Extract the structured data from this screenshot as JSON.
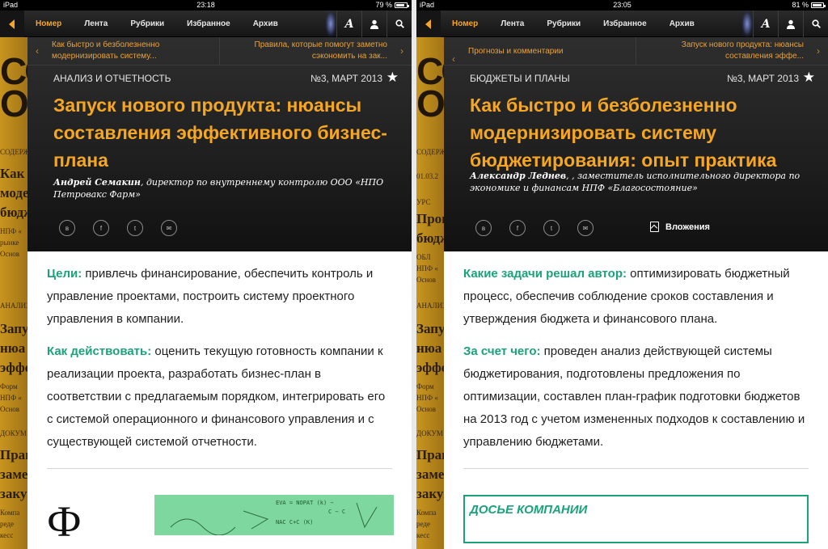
{
  "left": {
    "status": {
      "device": "iPad",
      "time": "23:18",
      "battery": "79 %",
      "battery_level": 0.79
    },
    "background_strip": [
      "СОДЕРЖ",
      "Как б",
      "моде",
      "бюдж",
      "НПФ «",
      "рынке",
      "Основ",
      "АНАЛИЗ",
      "Запу",
      "нюа",
      "эффе",
      "Форм",
      "НПФ «",
      "Основ",
      "ДОКУМ",
      "Прав",
      "заме",
      "закуп",
      "Компа",
      "реде",
      "кесс"
    ],
    "nav": {
      "tabs": [
        "Номер",
        "Лента",
        "Рубрики",
        "Избранное",
        "Архив"
      ],
      "active": "Номер",
      "font_button": "A"
    },
    "prev_link": "Как быстро и безболезненно модернизировать систему...",
    "next_link": "Правила, которые помогут заметно сэкономить на зак...",
    "rubric": "АНАЛИЗ И ОТЧЕТНОСТЬ",
    "issue": "№3, МАРТ 2013",
    "title": "Запуск нового продукта: нюансы составления эффективного бизнес-плана",
    "author_name": "Андрей Семакин",
    "author_role": ", директор по внутреннему контролю ООО «НПО Петровакс Фарм»",
    "share": [
      "в",
      "f",
      "t",
      "✉"
    ],
    "para1_label": "Цели:",
    "para1_text": " привлечь финансирование, обеспечить контроль и управление проектами, построить систему проектного управления в компании.",
    "para2_label": "Как действовать:",
    "para2_text": " оценить текущую готовность компании к реализации проекта, разработать бизнес-план в соответствии с предлагаемым порядком, интегрировать его с системой операционного и финансового управления и с существующей системой отчетности.",
    "big_letter": "Ф",
    "illus_text": [
      "EVA = NOPAT (k) −",
      "C − C",
      "NAC C+C (K)"
    ]
  },
  "right": {
    "status": {
      "device": "iPad",
      "time": "23:05",
      "battery": "81 %",
      "battery_level": 0.81
    },
    "background_strip": [
      "СОДЕРЖ",
      "01.03.2",
      "УРС",
      "Прог",
      "бюдж",
      "ОБЛ",
      "НПФ «",
      "Основ",
      "АНАЛИЗ",
      "Запу",
      "нюа",
      "эффе",
      "Форм",
      "НПФ «",
      "Основ",
      "ДОКУМ",
      "Прав",
      "заме",
      "закуп",
      "Компа",
      "реде",
      "кесс"
    ],
    "nav": {
      "tabs": [
        "Номер",
        "Лента",
        "Рубрики",
        "Избранное",
        "Архив"
      ],
      "active": "Номер",
      "font_button": "A"
    },
    "prev_link": "Прогнозы и комментарии",
    "next_link": "Запуск нового продукта: нюансы составления эффе...",
    "rubric": "БЮДЖЕТЫ И ПЛАНЫ",
    "issue": "№3, МАРТ 2013",
    "title": "Как быстро и безболезненно модернизировать систему бюджетирования: опыт практика",
    "author_name": "Александр Леднев",
    "author_role": ", , заместитель исполнительного директора по экономике и финансам НПФ «Благосостояние»",
    "share": [
      "в",
      "f",
      "t",
      "✉"
    ],
    "attachments": "Вложения",
    "para1_label": "Какие задачи решал автор:",
    "para1_text": " оптимизировать бюджетный процесс, обеспечив соблюдение сроков составления и утверждения бюджета и финансового плана.",
    "para2_label": "За счет чего:",
    "para2_text": " проведен анализ действующей системы бюджетирования, подготовлены предложения по оптимизации, составлен план-график подготовки бюджетов на 2013 год с учетом измененных подходов к составлению и управлению бюджетами.",
    "dossier": "ДОСЬЕ КОМПАНИИ"
  },
  "colors": {
    "accent": "#f5a623",
    "green": "#1aa37a",
    "header_bg": "#1e1e1e"
  }
}
